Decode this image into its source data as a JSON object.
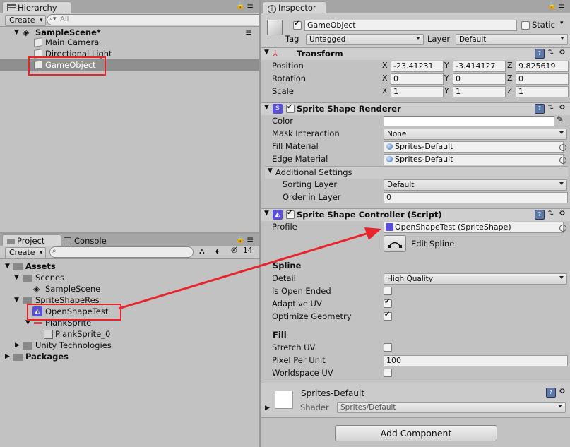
{
  "hierarchy": {
    "tab_label": "Hierarchy",
    "create_label": "Create",
    "search_placeholder": "All",
    "scene": "SampleScene*",
    "items": [
      "Main Camera",
      "Directional Light",
      "GameObject"
    ]
  },
  "project": {
    "tab_project": "Project",
    "tab_console": "Console",
    "create_label": "Create",
    "count_badge": "14",
    "tree": {
      "assets": "Assets",
      "scenes": "Scenes",
      "sample_scene": "SampleScene",
      "sprite_shape_res": "SpriteShapeRes",
      "open_shape_test": "OpenShapeTest",
      "plank_sprite": "PlankSprite",
      "plank_sprite_0": "PlankSprite_0",
      "unity_technologies": "Unity Technologies",
      "packages": "Packages"
    }
  },
  "inspector": {
    "tab_label": "Inspector",
    "object_name": "GameObject",
    "static_label": "Static",
    "tag_label": "Tag",
    "tag_value": "Untagged",
    "layer_label": "Layer",
    "layer_value": "Default",
    "transform": {
      "title": "Transform",
      "position_label": "Position",
      "rotation_label": "Rotation",
      "scale_label": "Scale",
      "x": "X",
      "y": "Y",
      "z": "Z",
      "position": [
        "-23.41231",
        "-3.414127",
        "9.825619"
      ],
      "rotation": [
        "0",
        "0",
        "0"
      ],
      "scale": [
        "1",
        "1",
        "1"
      ]
    },
    "renderer": {
      "title": "Sprite Shape Renderer",
      "color_label": "Color",
      "mask_label": "Mask Interaction",
      "mask_value": "None",
      "fill_material_label": "Fill Material",
      "fill_material_value": "Sprites-Default",
      "edge_material_label": "Edge Material",
      "edge_material_value": "Sprites-Default",
      "additional_label": "Additional Settings",
      "sorting_layer_label": "Sorting Layer",
      "sorting_layer_value": "Default",
      "order_label": "Order in Layer",
      "order_value": "0"
    },
    "controller": {
      "title": "Sprite Shape Controller (Script)",
      "profile_label": "Profile",
      "profile_value": "OpenShapeTest (SpriteShape)",
      "edit_spline_label": "Edit Spline",
      "spline_header": "Spline",
      "detail_label": "Detail",
      "detail_value": "High Quality",
      "open_ended_label": "Is Open Ended",
      "adaptive_uv_label": "Adaptive UV",
      "optimize_label": "Optimize Geometry",
      "fill_header": "Fill",
      "stretch_uv_label": "Stretch UV",
      "ppu_label": "Pixel Per Unit",
      "ppu_value": "100",
      "worldspace_uv_label": "Worldspace UV"
    },
    "material": {
      "name": "Sprites-Default",
      "shader_label": "Shader",
      "shader_value": "Sprites/Default"
    },
    "add_component_label": "Add Component"
  },
  "colors": {
    "highlight_box": "#e8242a",
    "arrow": "#e8242a",
    "selection": "#8f8f8f",
    "panel_bg": "#c2c2c2"
  },
  "icons": [
    "lock-icon",
    "menu-icon",
    "unity-scene-icon",
    "cube-icon",
    "folder-icon",
    "sprite-shape-icon",
    "help-icon",
    "settings-icon",
    "gear-icon",
    "object-picker-icon",
    "eyedropper-icon",
    "edit-spline-icon"
  ]
}
